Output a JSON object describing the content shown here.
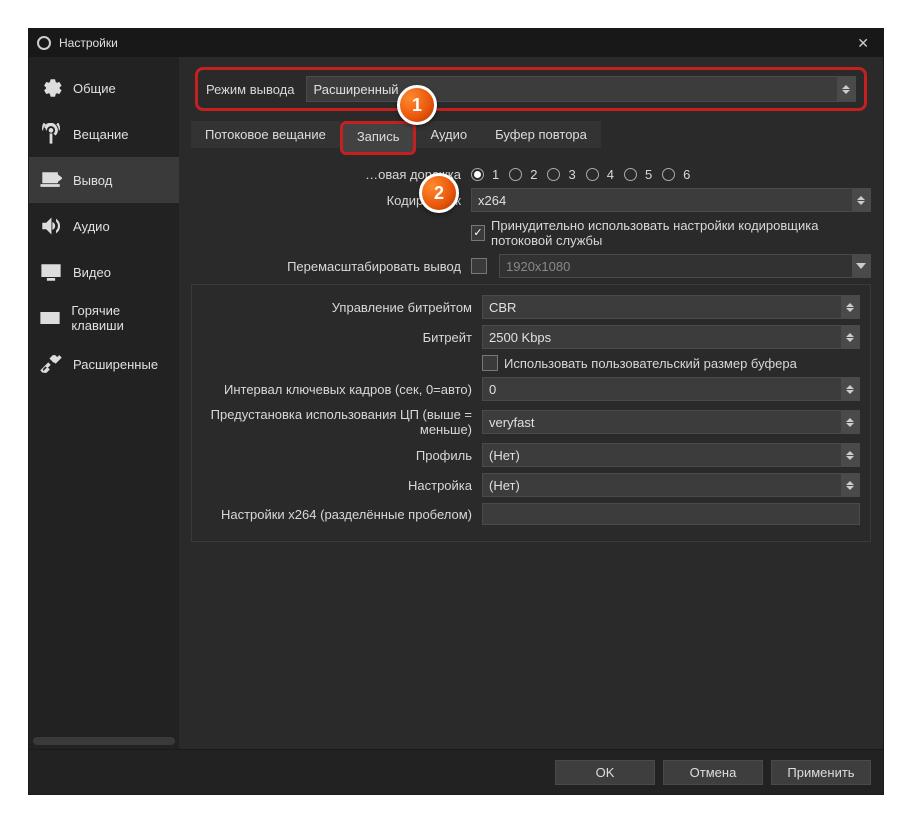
{
  "window": {
    "title": "Настройки"
  },
  "sidebar": {
    "items": [
      {
        "label": "Общие"
      },
      {
        "label": "Вещание"
      },
      {
        "label": "Вывод"
      },
      {
        "label": "Аудио"
      },
      {
        "label": "Видео"
      },
      {
        "label": "Горячие клавиши"
      },
      {
        "label": "Расширенные"
      }
    ]
  },
  "outputMode": {
    "label": "Режим вывода",
    "value": "Расширенный"
  },
  "tabs": {
    "streaming": "Потоковое вещание",
    "recording": "Запись",
    "audio": "Аудио",
    "replay": "Буфер повтора"
  },
  "markers": {
    "m1": "1",
    "m2": "2"
  },
  "fields": {
    "audioTrackLabel": "…овая дорожка",
    "audioTracks": [
      "1",
      "2",
      "3",
      "4",
      "5",
      "6"
    ],
    "encoderLabel": "Кодировщик",
    "encoderValue": "x264",
    "enforceLabel": "Принудительно использовать настройки кодировщика потоковой службы",
    "rescaleLabel": "Перемасштабировать вывод",
    "rescaleValue": "1920x1080",
    "rateControlLabel": "Управление битрейтом",
    "rateControlValue": "CBR",
    "bitrateLabel": "Битрейт",
    "bitrateValue": "2500 Kbps",
    "customBufferLabel": "Использовать пользовательский размер буфера",
    "keyframeLabel": "Интервал ключевых кадров (сек, 0=авто)",
    "keyframeValue": "0",
    "cpuPresetLabel": "Предустановка использования ЦП (выше = меньше)",
    "cpuPresetValue": "veryfast",
    "profileLabel": "Профиль",
    "profileValue": "(Нет)",
    "tuneLabel": "Настройка",
    "tuneValue": "(Нет)",
    "x264OptsLabel": "Настройки x264 (разделённые пробелом)"
  },
  "footer": {
    "ok": "OK",
    "cancel": "Отмена",
    "apply": "Применить"
  }
}
